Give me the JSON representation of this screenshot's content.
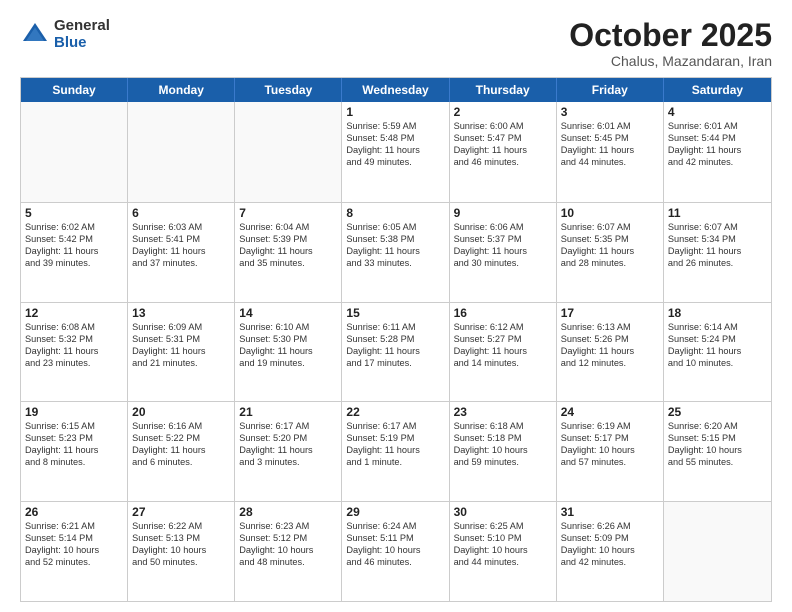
{
  "logo": {
    "general": "General",
    "blue": "Blue"
  },
  "header": {
    "month": "October 2025",
    "location": "Chalus, Mazandaran, Iran"
  },
  "weekdays": [
    "Sunday",
    "Monday",
    "Tuesday",
    "Wednesday",
    "Thursday",
    "Friday",
    "Saturday"
  ],
  "weeks": [
    [
      {
        "day": "",
        "lines": []
      },
      {
        "day": "",
        "lines": []
      },
      {
        "day": "",
        "lines": []
      },
      {
        "day": "1",
        "lines": [
          "Sunrise: 5:59 AM",
          "Sunset: 5:48 PM",
          "Daylight: 11 hours",
          "and 49 minutes."
        ]
      },
      {
        "day": "2",
        "lines": [
          "Sunrise: 6:00 AM",
          "Sunset: 5:47 PM",
          "Daylight: 11 hours",
          "and 46 minutes."
        ]
      },
      {
        "day": "3",
        "lines": [
          "Sunrise: 6:01 AM",
          "Sunset: 5:45 PM",
          "Daylight: 11 hours",
          "and 44 minutes."
        ]
      },
      {
        "day": "4",
        "lines": [
          "Sunrise: 6:01 AM",
          "Sunset: 5:44 PM",
          "Daylight: 11 hours",
          "and 42 minutes."
        ]
      }
    ],
    [
      {
        "day": "5",
        "lines": [
          "Sunrise: 6:02 AM",
          "Sunset: 5:42 PM",
          "Daylight: 11 hours",
          "and 39 minutes."
        ]
      },
      {
        "day": "6",
        "lines": [
          "Sunrise: 6:03 AM",
          "Sunset: 5:41 PM",
          "Daylight: 11 hours",
          "and 37 minutes."
        ]
      },
      {
        "day": "7",
        "lines": [
          "Sunrise: 6:04 AM",
          "Sunset: 5:39 PM",
          "Daylight: 11 hours",
          "and 35 minutes."
        ]
      },
      {
        "day": "8",
        "lines": [
          "Sunrise: 6:05 AM",
          "Sunset: 5:38 PM",
          "Daylight: 11 hours",
          "and 33 minutes."
        ]
      },
      {
        "day": "9",
        "lines": [
          "Sunrise: 6:06 AM",
          "Sunset: 5:37 PM",
          "Daylight: 11 hours",
          "and 30 minutes."
        ]
      },
      {
        "day": "10",
        "lines": [
          "Sunrise: 6:07 AM",
          "Sunset: 5:35 PM",
          "Daylight: 11 hours",
          "and 28 minutes."
        ]
      },
      {
        "day": "11",
        "lines": [
          "Sunrise: 6:07 AM",
          "Sunset: 5:34 PM",
          "Daylight: 11 hours",
          "and 26 minutes."
        ]
      }
    ],
    [
      {
        "day": "12",
        "lines": [
          "Sunrise: 6:08 AM",
          "Sunset: 5:32 PM",
          "Daylight: 11 hours",
          "and 23 minutes."
        ]
      },
      {
        "day": "13",
        "lines": [
          "Sunrise: 6:09 AM",
          "Sunset: 5:31 PM",
          "Daylight: 11 hours",
          "and 21 minutes."
        ]
      },
      {
        "day": "14",
        "lines": [
          "Sunrise: 6:10 AM",
          "Sunset: 5:30 PM",
          "Daylight: 11 hours",
          "and 19 minutes."
        ]
      },
      {
        "day": "15",
        "lines": [
          "Sunrise: 6:11 AM",
          "Sunset: 5:28 PM",
          "Daylight: 11 hours",
          "and 17 minutes."
        ]
      },
      {
        "day": "16",
        "lines": [
          "Sunrise: 6:12 AM",
          "Sunset: 5:27 PM",
          "Daylight: 11 hours",
          "and 14 minutes."
        ]
      },
      {
        "day": "17",
        "lines": [
          "Sunrise: 6:13 AM",
          "Sunset: 5:26 PM",
          "Daylight: 11 hours",
          "and 12 minutes."
        ]
      },
      {
        "day": "18",
        "lines": [
          "Sunrise: 6:14 AM",
          "Sunset: 5:24 PM",
          "Daylight: 11 hours",
          "and 10 minutes."
        ]
      }
    ],
    [
      {
        "day": "19",
        "lines": [
          "Sunrise: 6:15 AM",
          "Sunset: 5:23 PM",
          "Daylight: 11 hours",
          "and 8 minutes."
        ]
      },
      {
        "day": "20",
        "lines": [
          "Sunrise: 6:16 AM",
          "Sunset: 5:22 PM",
          "Daylight: 11 hours",
          "and 6 minutes."
        ]
      },
      {
        "day": "21",
        "lines": [
          "Sunrise: 6:17 AM",
          "Sunset: 5:20 PM",
          "Daylight: 11 hours",
          "and 3 minutes."
        ]
      },
      {
        "day": "22",
        "lines": [
          "Sunrise: 6:17 AM",
          "Sunset: 5:19 PM",
          "Daylight: 11 hours",
          "and 1 minute."
        ]
      },
      {
        "day": "23",
        "lines": [
          "Sunrise: 6:18 AM",
          "Sunset: 5:18 PM",
          "Daylight: 10 hours",
          "and 59 minutes."
        ]
      },
      {
        "day": "24",
        "lines": [
          "Sunrise: 6:19 AM",
          "Sunset: 5:17 PM",
          "Daylight: 10 hours",
          "and 57 minutes."
        ]
      },
      {
        "day": "25",
        "lines": [
          "Sunrise: 6:20 AM",
          "Sunset: 5:15 PM",
          "Daylight: 10 hours",
          "and 55 minutes."
        ]
      }
    ],
    [
      {
        "day": "26",
        "lines": [
          "Sunrise: 6:21 AM",
          "Sunset: 5:14 PM",
          "Daylight: 10 hours",
          "and 52 minutes."
        ]
      },
      {
        "day": "27",
        "lines": [
          "Sunrise: 6:22 AM",
          "Sunset: 5:13 PM",
          "Daylight: 10 hours",
          "and 50 minutes."
        ]
      },
      {
        "day": "28",
        "lines": [
          "Sunrise: 6:23 AM",
          "Sunset: 5:12 PM",
          "Daylight: 10 hours",
          "and 48 minutes."
        ]
      },
      {
        "day": "29",
        "lines": [
          "Sunrise: 6:24 AM",
          "Sunset: 5:11 PM",
          "Daylight: 10 hours",
          "and 46 minutes."
        ]
      },
      {
        "day": "30",
        "lines": [
          "Sunrise: 6:25 AM",
          "Sunset: 5:10 PM",
          "Daylight: 10 hours",
          "and 44 minutes."
        ]
      },
      {
        "day": "31",
        "lines": [
          "Sunrise: 6:26 AM",
          "Sunset: 5:09 PM",
          "Daylight: 10 hours",
          "and 42 minutes."
        ]
      },
      {
        "day": "",
        "lines": []
      }
    ]
  ]
}
